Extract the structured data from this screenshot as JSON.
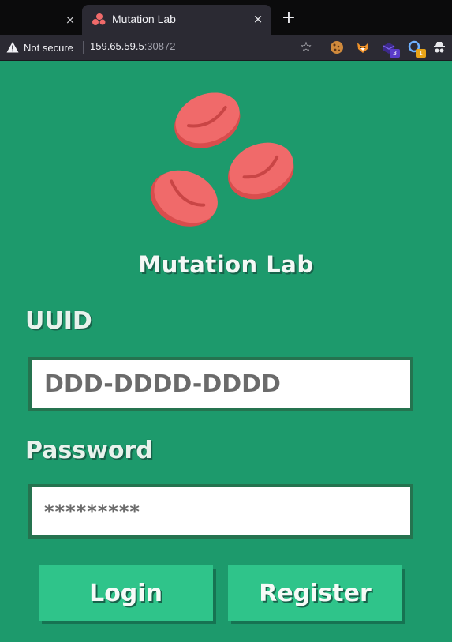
{
  "browser": {
    "active_tab_title": "Mutation Lab",
    "security_label": "Not secure",
    "url_host": "159.65.59.5",
    "url_port": ":30872",
    "extensions": [
      {
        "name": "cookie-icon"
      },
      {
        "name": "fox-icon"
      },
      {
        "name": "puzzle-icon",
        "badge": "3"
      },
      {
        "name": "search-extension-icon",
        "badge": "1"
      },
      {
        "name": "incognito-icon"
      }
    ],
    "icons": {
      "close": "×",
      "new_tab": "+",
      "bookmark": "☆"
    }
  },
  "page": {
    "brand_title": "Mutation Lab",
    "uuid_label": "UUID",
    "uuid_placeholder": "DDD-DDDD-DDDD",
    "password_label": "Password",
    "password_value": "*********",
    "login_button": "Login",
    "register_button": "Register"
  },
  "colors": {
    "background": "#1d9a6c",
    "button": "#2fc48a",
    "input_border": "#25734f",
    "blood_cell": "#f06a6a"
  }
}
